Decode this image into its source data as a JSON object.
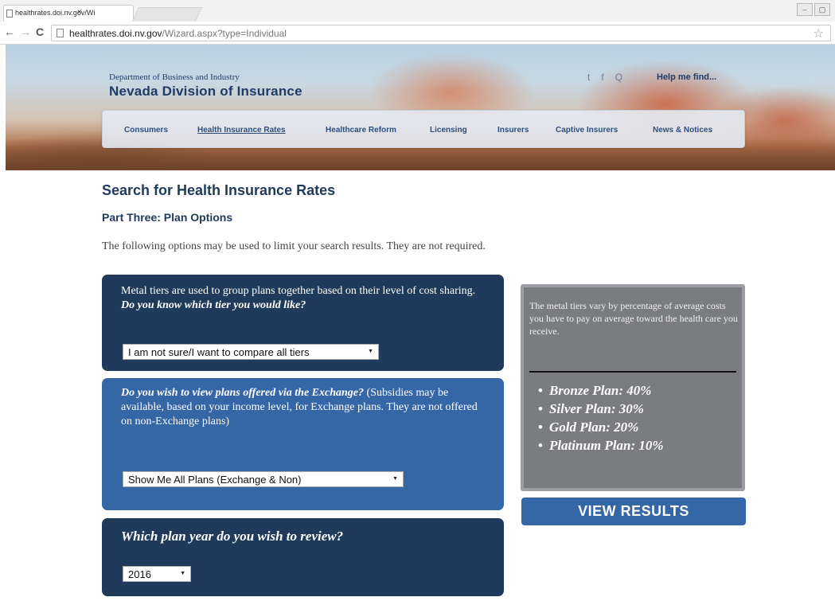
{
  "browser": {
    "tab_title": "healthrates.doi.nv.gov/Wi",
    "tab_close": "×",
    "url_host": "healthrates.doi.nv.gov",
    "url_path": "/Wizard.aspx?type=Individual"
  },
  "header": {
    "department": "Department of Business and Industry",
    "title": "Nevada Division of Insurance",
    "social": [
      "t",
      "f",
      "Q"
    ],
    "help_link": "Help me find...",
    "nav": [
      {
        "label": "Consumers"
      },
      {
        "label": "Health Insurance Rates",
        "active": true
      },
      {
        "label": "Healthcare Reform"
      },
      {
        "label": "Licensing"
      },
      {
        "label": "Insurers"
      },
      {
        "label": "Captive Insurers"
      },
      {
        "label": "News & Notices"
      }
    ]
  },
  "main": {
    "title": "Search for Health Insurance Rates",
    "subtitle": "Part Three: Plan Options",
    "intro": "The following options may be used to limit your search results. They are not required."
  },
  "tier_card": {
    "text": "Metal tiers are used to group plans together based on their level of cost sharing. ",
    "question": "Do you know which tier you would like?",
    "select_value": "I am not sure/I want to compare all tiers"
  },
  "exchange_card": {
    "question": "Do you wish to view plans offered via the Exchange?",
    "text": " (Subsidies may be available, based on your income level, for Exchange plans. They are not offered on non-Exchange plans)",
    "select_value": "Show Me All Plans (Exchange & Non)"
  },
  "year_card": {
    "question": "Which plan year do you wish to review?",
    "select_value": "2016"
  },
  "info_panel": {
    "text": "The metal tiers vary by percentage of average costs you have to pay on average toward the health care you receive.",
    "items": [
      "Bronze Plan: 40%",
      "Silver Plan: 30%",
      "Gold Plan: 20%",
      "Platinum Plan: 10%"
    ]
  },
  "view_results_label": "VIEW RESULTS"
}
